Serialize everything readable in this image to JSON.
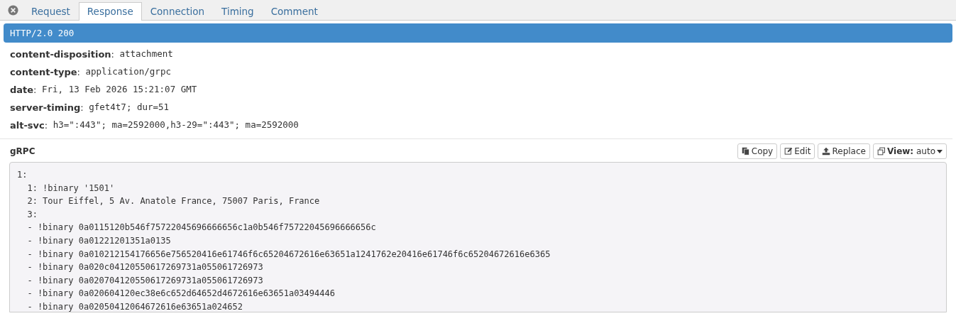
{
  "tabs": [
    {
      "label": "Request",
      "selected": false
    },
    {
      "label": "Response",
      "selected": true
    },
    {
      "label": "Connection",
      "selected": false
    },
    {
      "label": "Timing",
      "selected": false
    },
    {
      "label": "Comment",
      "selected": false
    }
  ],
  "status_line": "HTTP/2.0 200",
  "headers": [
    {
      "name": "**content-disposition**:",
      "value": "attachment"
    },
    {
      "name": "**content-type**:",
      "value": "application/grpc"
    },
    {
      "name": "**date**:",
      "value": "Fri, 13 Feb 2026 15:21:07 GMT"
    },
    {
      "name": "**server-timing**:",
      "value": "gfet4t7; dur=51"
    },
    {
      "name": "**alt-svc**:",
      "value": "h3=\":443\"; ma=2592000,h3-29=\":443\"; ma=2592000"
    }
  ],
  "body": {
    "title": "gRPC",
    "buttons": [
      {
        "kind": "copy",
        "label": "Copy"
      },
      {
        "kind": "edit",
        "label": "Edit"
      },
      {
        "kind": "replace",
        "label": "Replace"
      },
      {
        "kind": "view",
        "label": "**View:** auto"
      }
    ],
    "lines": [
      "1:",
      "  1: !binary '1501'",
      "  2: Tour Eiffel, 5 Av. Anatole France, 75007 Paris, France",
      "  3:",
      "  - !binary 0a0115120b546f75722045696666656c1a0b546f75722045696666656c",
      "  - !binary 0a01221201351a0135",
      "  - !binary 0a010212154176656e756520416e61746f6c65204672616e63651a1241762e20416e61746f6c65204672616e6365",
      "  - !binary 0a020c04120550617269731a055061726973",
      "  - !binary 0a020704120550617269731a055061726973",
      "  - !binary 0a020604120ec38e6c652d64652d4672616e63651a03494446",
      "  - !binary 0a02050412064672616e63651a024652"
    ]
  }
}
